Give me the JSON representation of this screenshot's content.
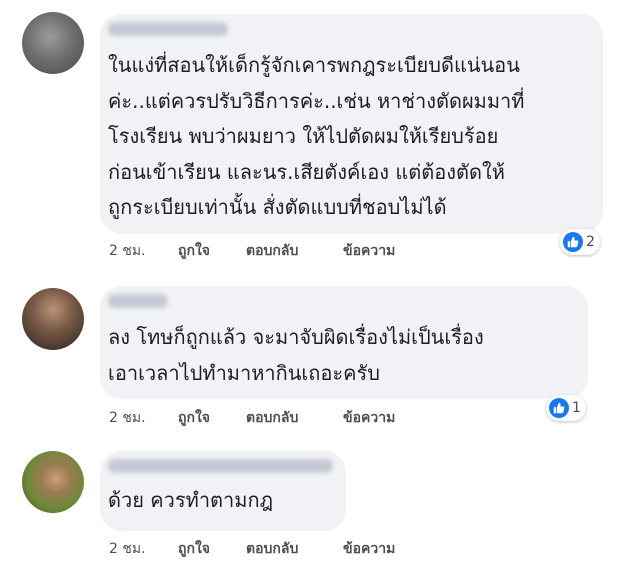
{
  "colors": {
    "bubble": "#f0f2f5",
    "text": "#1c1e21",
    "meta": "#4b4f56",
    "like": "#1877f2"
  },
  "comments": [
    {
      "lines": [
        "ในแง่ที่สอนให้เด็กรู้จักเคารพกฎระเบียบดีแน่นอน",
        "ค่ะ..แต่ควรปรับวิธีการค่ะ..เช่น หาช่างตัดผมมาที่",
        "โรงเรียน พบว่าผมยาว ให้ไปตัดผมให้เรียบร้อย",
        "ก่อนเข้าเรียน และนร.เสียตังค์เอง แต่ต้องตัดให้",
        "ถูกระเบียบเท่านั้น สั่งตัดแบบที่ชอบไม่ได้"
      ],
      "time": "2 ชม.",
      "like": "ถูกใจ",
      "reply": "ตอบกลับ",
      "message": "ข้อความ",
      "reaction_icon": "like-icon",
      "reaction_count": "2"
    },
    {
      "lines": [
        "ลง โทษก็ถูกแล้ว จะมาจับผิดเรื่องไม่เป็นเรื่อง",
        "เอาเวลาไปทำมาหากินเถอะครับ"
      ],
      "time": "2 ชม.",
      "like": "ถูกใจ",
      "reply": "ตอบกลับ",
      "message": "ข้อความ",
      "reaction_icon": "like-icon",
      "reaction_count": "1"
    },
    {
      "lines": [
        "ด้วย ควรทำตามกฎ"
      ],
      "time": "2 ชม.",
      "like": "ถูกใจ",
      "reply": "ตอบกลับ",
      "message": "ข้อความ"
    }
  ]
}
